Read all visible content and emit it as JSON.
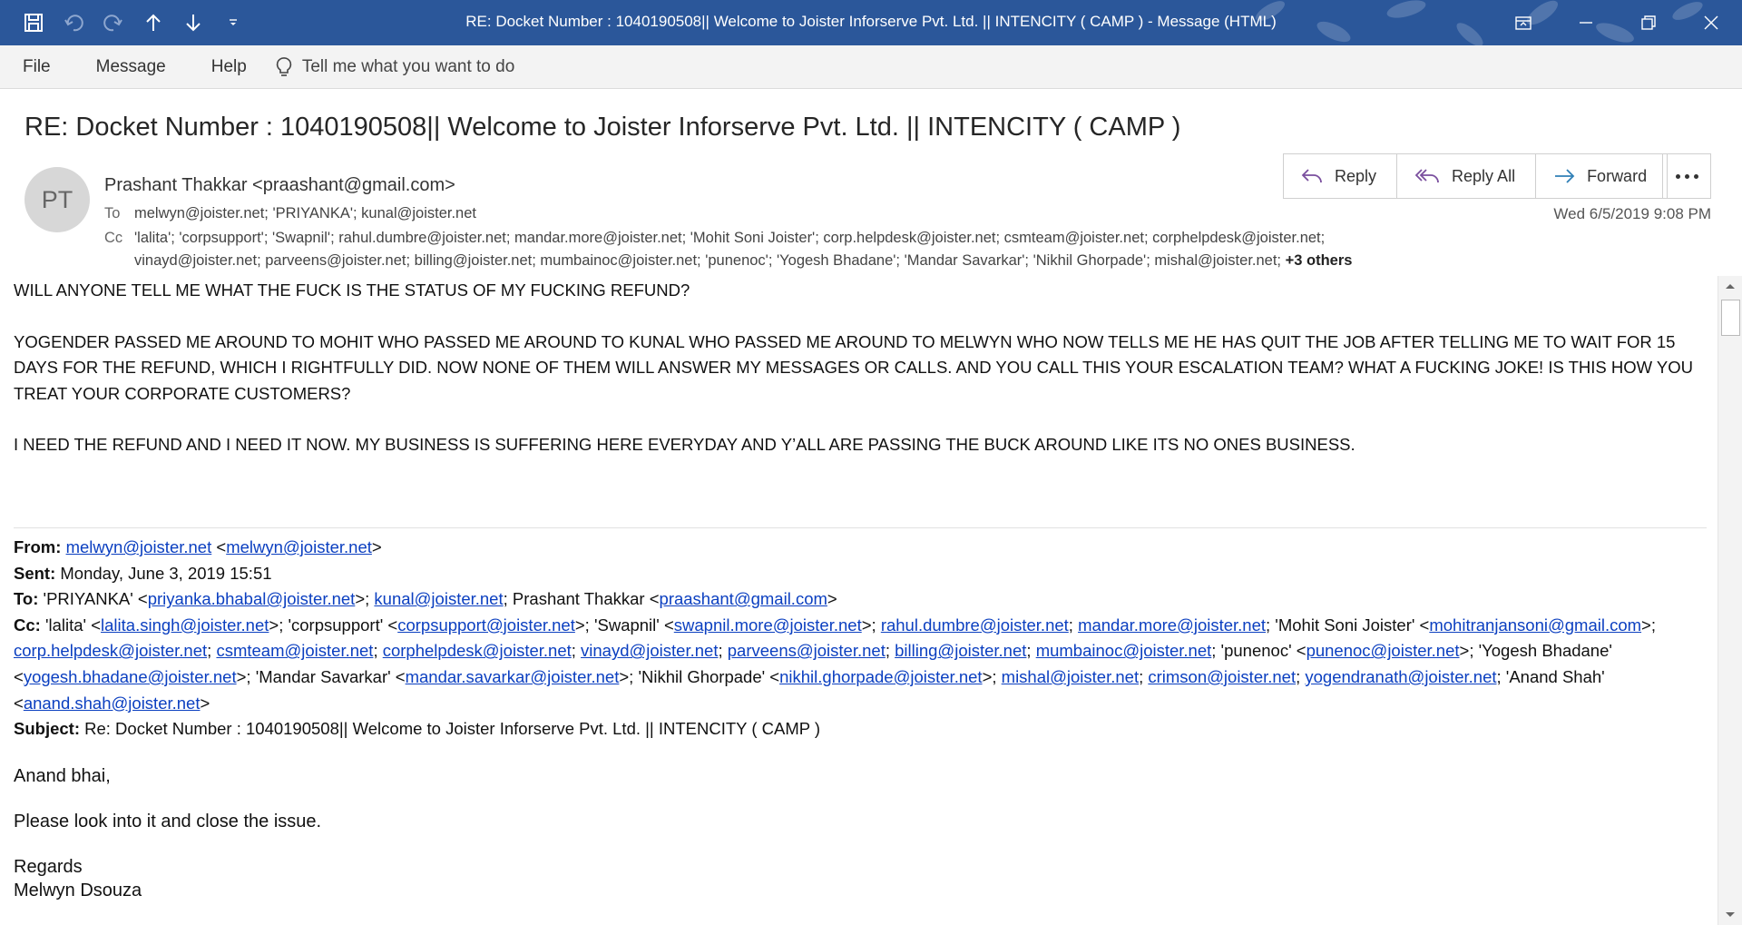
{
  "window": {
    "title": "RE: Docket Number : 1040190508|| Welcome to Joister Inforserve Pvt. Ltd. || INTENCITY ( CAMP )  -  Message (HTML)"
  },
  "menu": {
    "file": "File",
    "message": "Message",
    "help": "Help",
    "tell_me": "Tell me what you want to do"
  },
  "email": {
    "subject": "RE: Docket Number : 1040190508|| Welcome to Joister Inforserve Pvt. Ltd. || INTENCITY ( CAMP )",
    "avatar_initials": "PT",
    "sender": "Prashant Thakkar <praashant@gmail.com>",
    "to_label": "To",
    "to": "melwyn@joister.net; 'PRIYANKA'; kunal@joister.net",
    "cc_label": "Cc",
    "cc_line1": "'lalita'; 'corpsupport'; 'Swapnil'; rahul.dumbre@joister.net; mandar.more@joister.net; 'Mohit Soni Joister'; corp.helpdesk@joister.net; csmteam@joister.net; corphelpdesk@joister.net;",
    "cc_line2": "vinayd@joister.net; parveens@joister.net; billing@joister.net; mumbainoc@joister.net; 'punenoc'; 'Yogesh Bhadane'; 'Mandar Savarkar'; 'Nikhil Ghorpade'; mishal@joister.net;",
    "cc_more": "+3 others",
    "date": "Wed 6/5/2019 9:08 PM"
  },
  "actions": {
    "reply": "Reply",
    "reply_all": "Reply All",
    "forward": "Forward"
  },
  "body": {
    "para1": "WILL ANYONE TELL ME WHAT THE FUCK IS THE STATUS OF MY FUCKING REFUND?",
    "para2": "YOGENDER PASSED ME AROUND TO MOHIT WHO PASSED ME AROUND TO KUNAL WHO PASSED ME AROUND TO MELWYN WHO NOW TELLS ME HE HAS QUIT THE JOB AFTER TELLING ME TO WAIT FOR 15 DAYS FOR THE REFUND, WHICH I RIGHTFULLY DID. NOW NONE OF THEM WILL ANSWER MY MESSAGES OR CALLS. AND YOU CALL THIS YOUR ESCALATION TEAM? WHAT A FUCKING JOKE! IS THIS HOW YOU TREAT YOUR CORPORATE CUSTOMERS?",
    "para3": "I NEED THE REFUND AND I NEED IT NOW. MY BUSINESS IS SUFFERING HERE EVERYDAY AND Y’ALL ARE PASSING THE BUCK AROUND LIKE ITS NO ONES BUSINESS."
  },
  "quoted": {
    "from_label": "From:",
    "from_link1": "melwyn@joister.net",
    "from_link2": "melwyn@joister.net",
    "sent_label": "Sent:",
    "sent": "Monday, June 3, 2019 15:51",
    "to_label": "To:",
    "to_name1": "'PRIYANKA' <",
    "to_link1": "priyanka.bhabal@joister.net",
    "to_sep1": ">; ",
    "to_link2": "kunal@joister.net",
    "to_name3": "; Prashant Thakkar <",
    "to_link3": "praashant@gmail.com",
    "cc_label": "Cc:",
    "cc": [
      {
        "t": "'lalita' <"
      },
      {
        "l": "lalita.singh@joister.net"
      },
      {
        "t": ">; 'corpsupport' <"
      },
      {
        "l": "corpsupport@joister.net"
      },
      {
        "t": ">; 'Swapnil' <"
      },
      {
        "l": "swapnil.more@joister.net"
      },
      {
        "t": ">; "
      },
      {
        "l": "rahul.dumbre@joister.net"
      },
      {
        "t": "; "
      },
      {
        "l": "mandar.more@joister.net"
      },
      {
        "t": "; 'Mohit Soni Joister' <"
      },
      {
        "l": "mohitranjansoni@gmail.com"
      },
      {
        "t": ">; "
      },
      {
        "l": "corp.helpdesk@joister.net"
      },
      {
        "t": "; "
      },
      {
        "l": "csmteam@joister.net"
      },
      {
        "t": "; "
      },
      {
        "l": "corphelpdesk@joister.net"
      },
      {
        "t": "; "
      },
      {
        "l": "vinayd@joister.net"
      },
      {
        "t": "; "
      },
      {
        "l": "parveens@joister.net"
      },
      {
        "t": "; "
      },
      {
        "l": "billing@joister.net"
      },
      {
        "t": "; "
      },
      {
        "l": "mumbainoc@joister.net"
      },
      {
        "t": "; 'punenoc' <"
      },
      {
        "l": "punenoc@joister.net"
      },
      {
        "t": ">; 'Yogesh Bhadane' <"
      },
      {
        "l": "yogesh.bhadane@joister.net"
      },
      {
        "t": ">; 'Mandar Savarkar' <"
      },
      {
        "l": "mandar.savarkar@joister.net"
      },
      {
        "t": ">; 'Nikhil Ghorpade' <"
      },
      {
        "l": "nikhil.ghorpade@joister.net"
      },
      {
        "t": ">; "
      },
      {
        "l": "mishal@joister.net"
      },
      {
        "t": "; "
      },
      {
        "l": "crimson@joister.net"
      },
      {
        "t": "; "
      },
      {
        "l": "yogendranath@joister.net"
      },
      {
        "t": "; 'Anand Shah' <"
      },
      {
        "l": "anand.shah@joister.net"
      },
      {
        "t": ">"
      }
    ],
    "subject_label": "Subject:",
    "subject": "Re: Docket Number : 1040190508|| Welcome to Joister Inforserve Pvt. Ltd. || INTENCITY ( CAMP )",
    "greeting": "Anand bhai,",
    "line": "Please look into it and close the issue.",
    "regards": "Regards",
    "signature": "Melwyn Dsouza"
  }
}
